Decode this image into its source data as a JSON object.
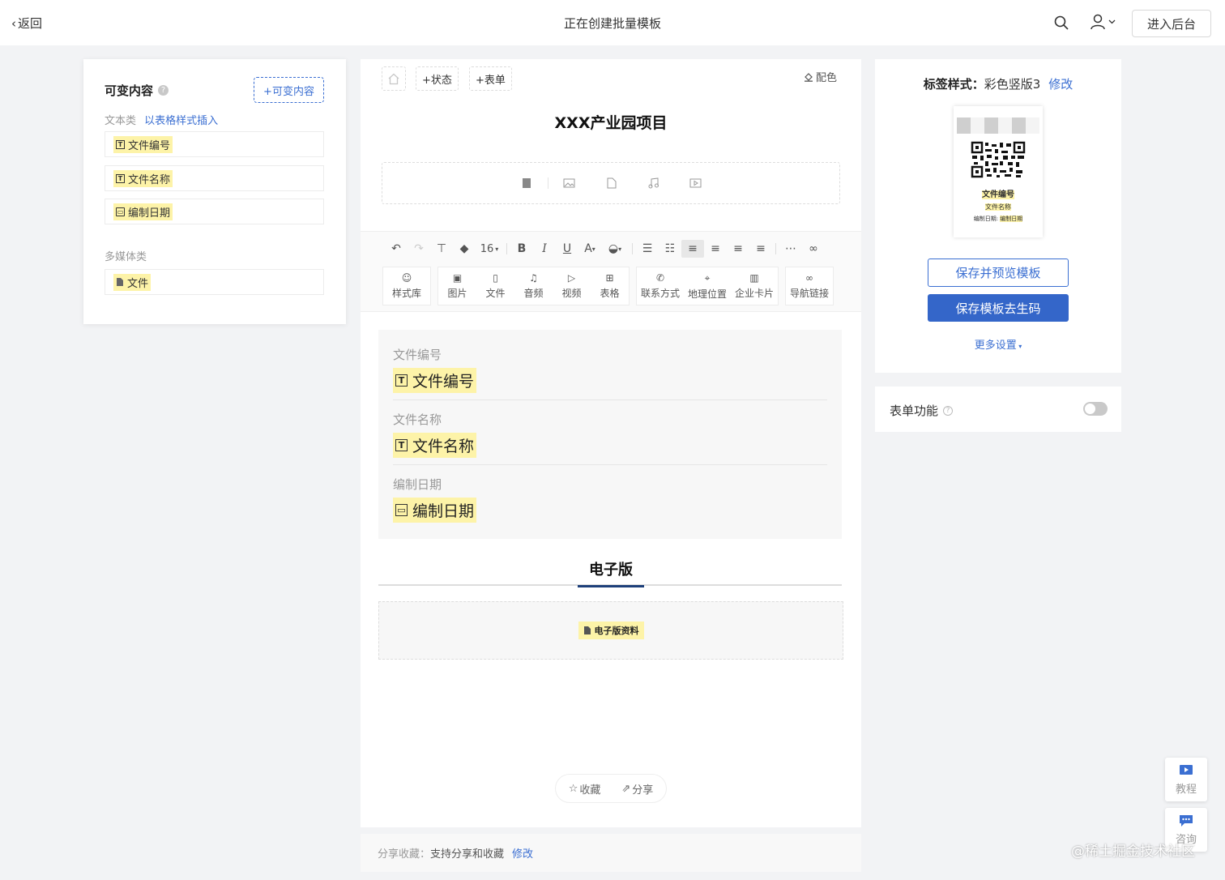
{
  "header": {
    "back_label": "返回",
    "title": "正在创建批量模板",
    "enter_admin_label": "进入后台"
  },
  "left": {
    "title": "可变内容",
    "add_button": "+可变内容",
    "text_section": "文本类",
    "insert_table_link": "以表格样式插入",
    "text_items": [
      "文件编号",
      "文件名称",
      "编制日期"
    ],
    "media_section": "多媒体类",
    "media_items": [
      "文件"
    ]
  },
  "editor": {
    "status_button": "+状态",
    "form_button": "+表单",
    "color_button": "配色",
    "doc_title": "XXX产业园项目",
    "font_size": "16",
    "insert_tools": [
      "样式库",
      "图片",
      "文件",
      "音频",
      "视频",
      "表格",
      "联系方式",
      "地理位置",
      "企业卡片",
      "导航链接"
    ],
    "fields": [
      {
        "label": "文件编号",
        "value": "文件编号"
      },
      {
        "label": "文件名称",
        "value": "文件名称"
      },
      {
        "label": "编制日期",
        "value": "编制日期"
      }
    ],
    "tab": "电子版",
    "file_chip": "电子版资料",
    "fav_label": "收藏",
    "share_label": "分享"
  },
  "share_bar": {
    "label": "分享收藏：",
    "value": "支持分享和收藏",
    "edit_link": "修改"
  },
  "right": {
    "style_label": "标签样式：",
    "style_value": "彩色竖版3",
    "edit_link": "修改",
    "card_line1": "文件编号",
    "card_line2": "文件名称",
    "card_line3_label": "编制日期: ",
    "card_line3_value": "编制日期",
    "preview_button": "保存并预览模板",
    "generate_button": "保存模板去生码",
    "more_settings": "更多设置",
    "form_feature_label": "表单功能",
    "form_feature_enabled": false
  },
  "side": {
    "tutorial": "教程",
    "consult": "咨询"
  },
  "watermark": "@稀土掘金技术社区",
  "colors": {
    "primary": "#3466c9",
    "link": "#3b6fd2",
    "highlight": "#fdf3a8"
  }
}
